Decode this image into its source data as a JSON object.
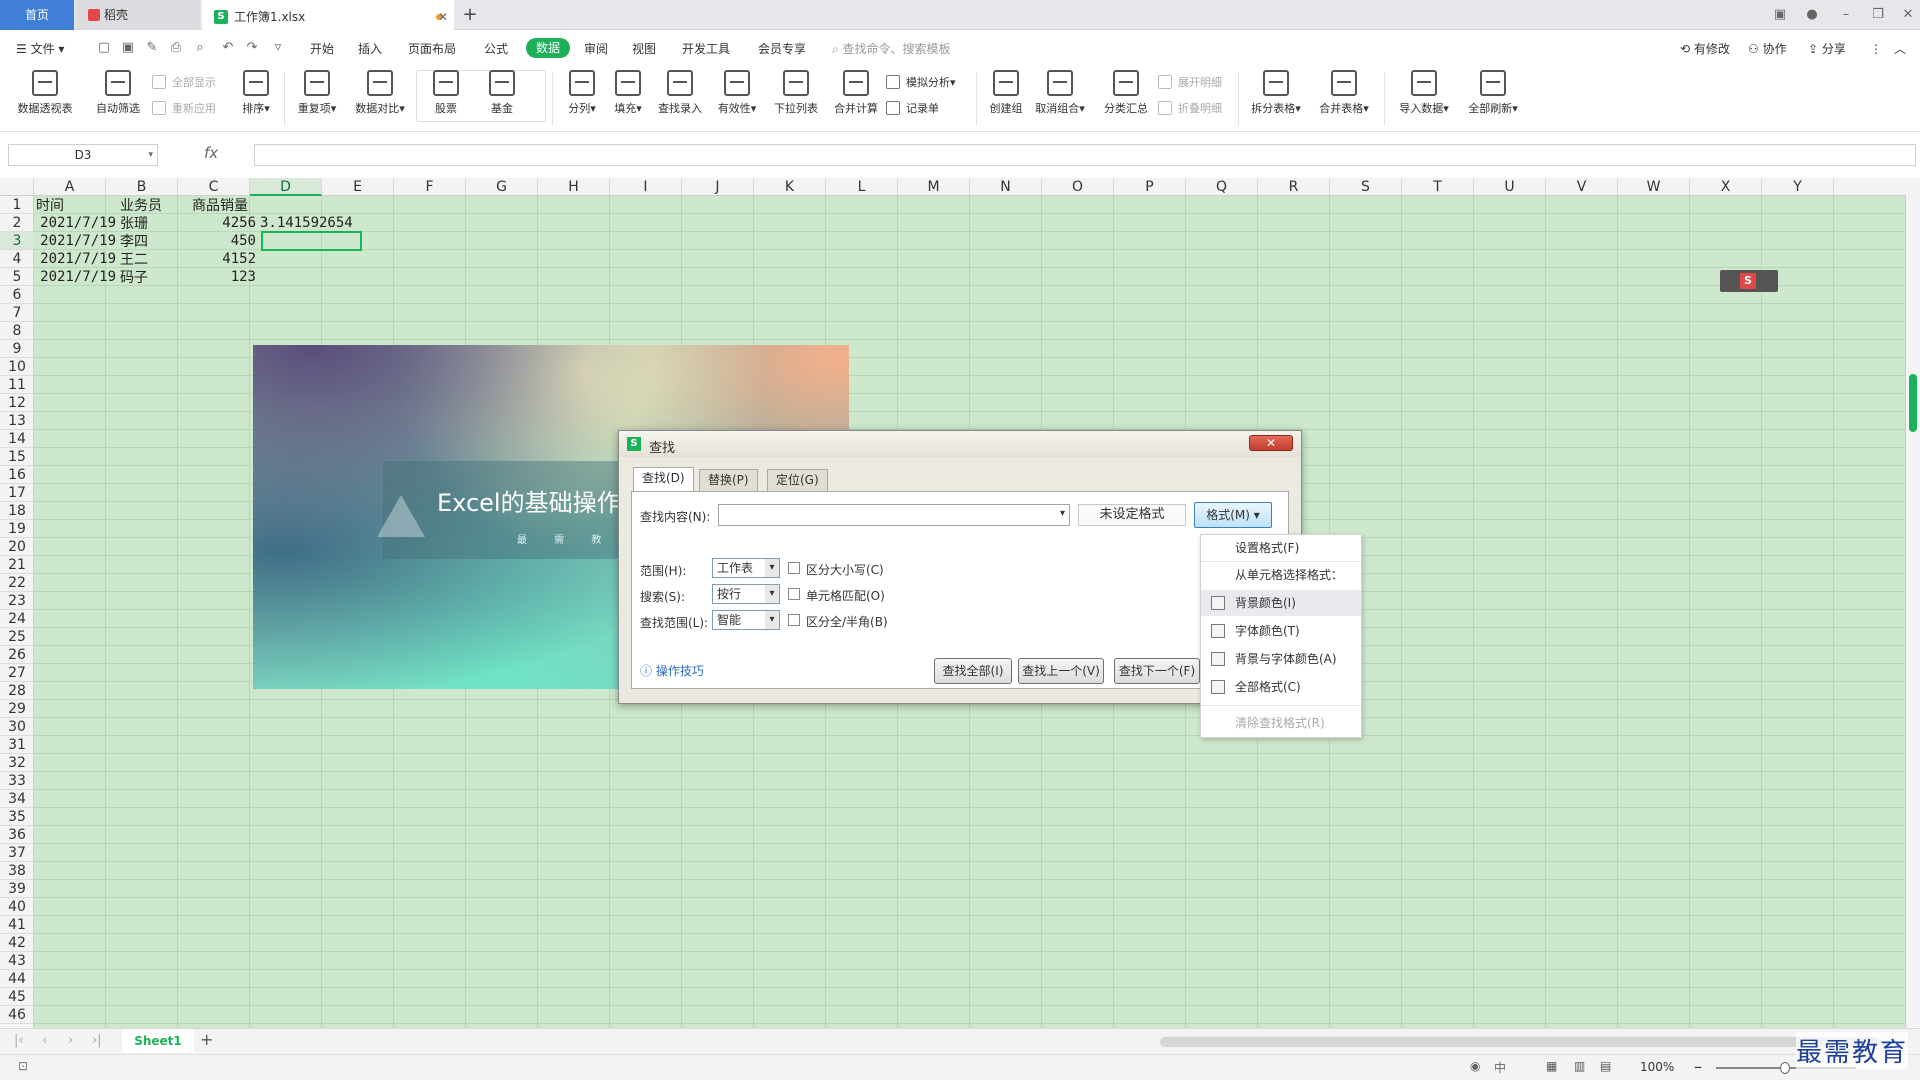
{
  "tabs": {
    "home": "首页",
    "daoke": "稻壳",
    "workbook": "工作簿1.xlsx",
    "add": "+"
  },
  "menu": {
    "file": "文件",
    "items": [
      "开始",
      "插入",
      "页面布局",
      "公式",
      "数据",
      "审阅",
      "视图",
      "开发工具",
      "会员专享"
    ],
    "search_placeholder": "查找命令、搜索模板",
    "right": [
      "有修改",
      "协作",
      "分享"
    ]
  },
  "ribbon": {
    "pivot": "数据透视表",
    "autofilter": "自动筛选",
    "showall": "全部显示",
    "reapply": "重新应用",
    "sort": "排序",
    "dup": "重复项",
    "compare": "数据对比",
    "stock": "股票",
    "fund": "基金",
    "split": "分列",
    "fill": "填充",
    "lookup": "查找录入",
    "validity": "有效性",
    "dropdown": "下拉列表",
    "consolidate": "合并计算",
    "whatif": "模拟分析",
    "record": "记录单",
    "group": "创建组",
    "ungroup": "取消组合",
    "subtotal": "分类汇总",
    "expand": "展开明细",
    "collapse": "折叠明细",
    "splittable": "拆分表格",
    "mergetable": "合并表格",
    "import": "导入数据",
    "refresh": "全部刷新"
  },
  "formula": {
    "namebox": "D3",
    "fx": "fx",
    "value": ""
  },
  "columns": [
    "A",
    "B",
    "C",
    "D",
    "E",
    "F",
    "G",
    "H",
    "I",
    "J",
    "K",
    "L",
    "M",
    "N",
    "O",
    "P",
    "Q",
    "R",
    "S",
    "T",
    "U",
    "V",
    "W",
    "X",
    "Y"
  ],
  "rows": [
    "1",
    "2",
    "3",
    "4",
    "5",
    "6",
    "7",
    "8",
    "9",
    "10",
    "11",
    "12",
    "13",
    "14",
    "15",
    "16",
    "17",
    "18",
    "19",
    "20",
    "21",
    "22",
    "23",
    "24",
    "25",
    "26",
    "27",
    "28",
    "29",
    "30",
    "31",
    "32",
    "33",
    "34",
    "35",
    "36",
    "37",
    "38",
    "39",
    "40",
    "41",
    "42",
    "43",
    "44",
    "45",
    "46"
  ],
  "table": {
    "headers": [
      "时间",
      "业务员",
      "商品销量"
    ],
    "rows": [
      {
        "date": "2021/7/19",
        "name": "张珊",
        "qty": "4256",
        "extra": "3.141592654"
      },
      {
        "date": "2021/7/19",
        "name": "李四",
        "qty": "450",
        "extra": ""
      },
      {
        "date": "2021/7/19",
        "name": "王二",
        "qty": "4152",
        "extra": ""
      },
      {
        "date": "2021/7/19",
        "name": "码子",
        "qty": "123",
        "extra": ""
      }
    ]
  },
  "banner": {
    "title": "Excel的基础操作",
    "subtitle": "最 需 教 育"
  },
  "sheet": {
    "name": "Sheet1",
    "add": "+"
  },
  "status": {
    "zoom": "100%"
  },
  "watermark": "最需教育",
  "dialog": {
    "title": "查找",
    "tabs": [
      "查找(D)",
      "替换(P)",
      "定位(G)"
    ],
    "find_label": "查找内容(N):",
    "find_value": "",
    "no_format": "未设定格式",
    "format_btn": "格式(M) ▾",
    "scope_label": "范围(H):",
    "scope_value": "工作表",
    "search_label": "搜索(S):",
    "search_value": "按行",
    "lookin_label": "查找范围(L):",
    "lookin_value": "智能",
    "case": "区分大小写(C)",
    "whole": "单元格匹配(O)",
    "width": "区分全/半角(B)",
    "tips": "操作技巧",
    "find_all": "查找全部(I)",
    "find_prev": "查找上一个(V)",
    "find_next": "查找下一个(F)",
    "close": "✕"
  },
  "format_menu": {
    "set": "设置格式(F)",
    "from_cell": "从单元格选择格式：",
    "bg": "背景颜色(I)",
    "font": "字体颜色(T)",
    "both": "背景与字体颜色(A)",
    "all": "全部格式(C)",
    "clear": "清除查找格式(R)"
  }
}
